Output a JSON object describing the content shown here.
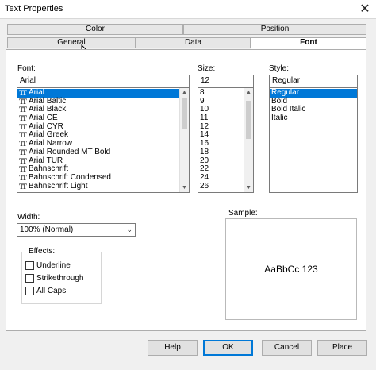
{
  "window": {
    "title": "Text Properties",
    "close_glyph": "✕"
  },
  "tabs": {
    "back_row": [
      {
        "label": "Color"
      },
      {
        "label": "Position"
      }
    ],
    "front_row": [
      {
        "label": "General"
      },
      {
        "label": "Data"
      },
      {
        "label": "Font",
        "active": true
      }
    ]
  },
  "font": {
    "label": "Font:",
    "value": "Arial",
    "icon": "truetype-icon",
    "list": [
      "Arial",
      "Arial Baltic",
      "Arial Black",
      "Arial CE",
      "Arial CYR",
      "Arial Greek",
      "Arial Narrow",
      "Arial Rounded MT Bold",
      "Arial TUR",
      "Bahnschrift",
      "Bahnschrift Condensed",
      "Bahnschrift Light"
    ],
    "selected": "Arial"
  },
  "size": {
    "label": "Size:",
    "value": "12",
    "list": [
      "8",
      "9",
      "10",
      "11",
      "12",
      "14",
      "16",
      "18",
      "20",
      "22",
      "24",
      "26"
    ]
  },
  "style": {
    "label": "Style:",
    "value": "Regular",
    "list": [
      "Regular",
      "Bold",
      "Bold Italic",
      "Italic"
    ],
    "selected": "Regular"
  },
  "width": {
    "label": "Width:",
    "value": "100% (Normal)"
  },
  "effects": {
    "label": "Effects:",
    "items": [
      {
        "label": "Underline",
        "checked": false
      },
      {
        "label": "Strikethrough",
        "checked": false
      },
      {
        "label": "All Caps",
        "checked": false
      }
    ]
  },
  "sample": {
    "label": "Sample:",
    "text": "AaBbCc 123"
  },
  "buttons": {
    "help": "Help",
    "ok": "OK",
    "cancel": "Cancel",
    "place": "Place"
  },
  "colors": {
    "accent": "#0078d7",
    "dialog_bg": "#f0f0f0",
    "pane_bg": "#ffffff"
  }
}
